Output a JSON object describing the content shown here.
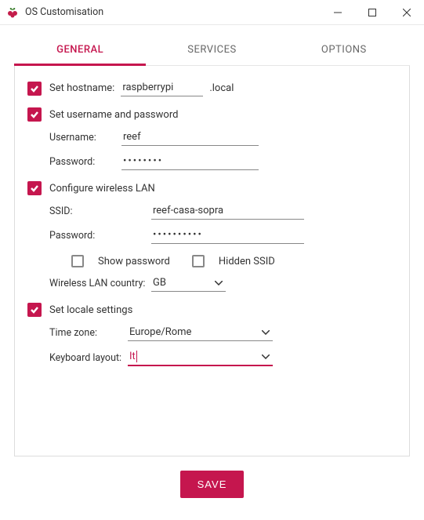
{
  "window": {
    "title": "OS Customisation"
  },
  "tabs": {
    "general": "GENERAL",
    "services": "SERVICES",
    "options": "OPTIONS"
  },
  "hostname": {
    "label": "Set hostname:",
    "value": "raspberrypi",
    "suffix": ".local"
  },
  "userpass": {
    "label": "Set username and password",
    "username_label": "Username:",
    "username_value": "reef",
    "password_label": "Password:",
    "password_value": "••••••••"
  },
  "wlan": {
    "label": "Configure wireless LAN",
    "ssid_label": "SSID:",
    "ssid_value": "reef-casa-sopra",
    "password_label": "Password:",
    "password_value": "••••••••••",
    "show_password_label": "Show password",
    "hidden_ssid_label": "Hidden SSID",
    "country_label": "Wireless LAN country:",
    "country_value": "GB"
  },
  "locale": {
    "label": "Set locale settings",
    "tz_label": "Time zone:",
    "tz_value": "Europe/Rome",
    "kb_label": "Keyboard layout:",
    "kb_value": "It"
  },
  "buttons": {
    "save": "SAVE"
  }
}
